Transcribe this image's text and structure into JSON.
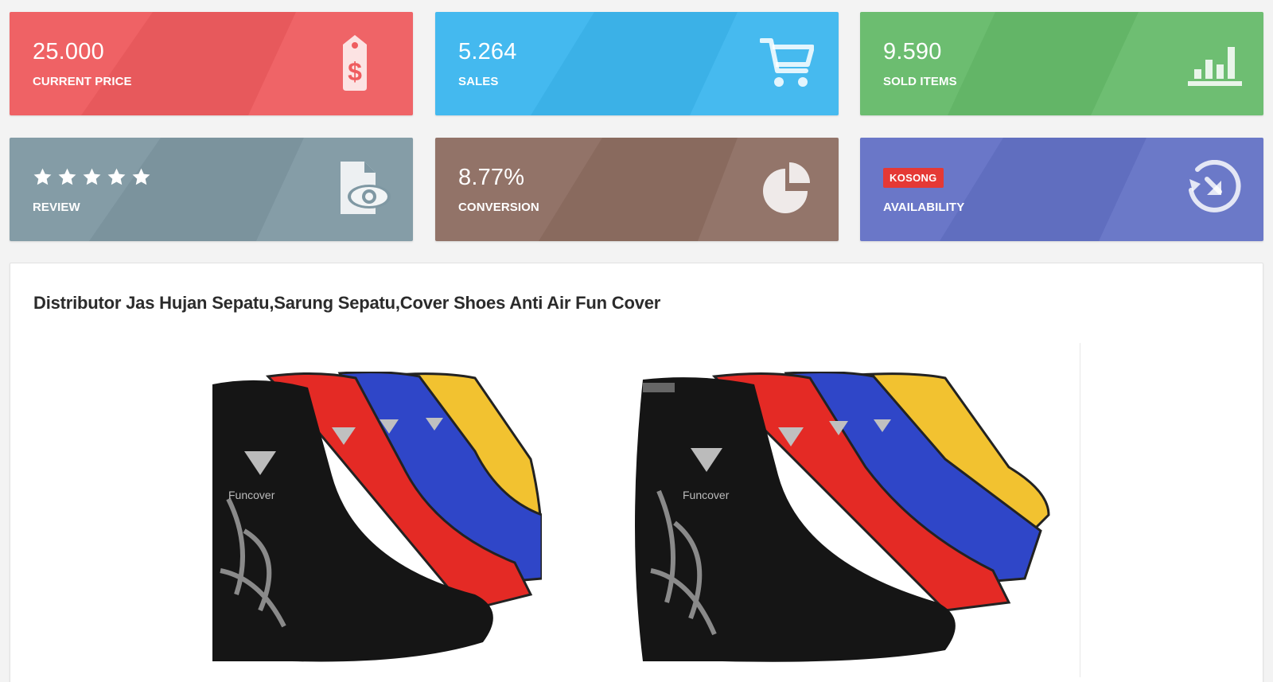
{
  "cards": [
    {
      "value": "25.000",
      "label": "CURRENT PRICE",
      "icon": "price-tag-icon",
      "color": "#ef5c5f"
    },
    {
      "value": "5.264",
      "label": "SALES",
      "icon": "shopping-cart-icon",
      "color": "#3db7ef"
    },
    {
      "value": "9.590",
      "label": "SOLD ITEMS",
      "icon": "bar-chart-icon",
      "color": "#67bb6b"
    },
    {
      "label": "REVIEW",
      "rating": 5,
      "icon": "document-eye-icon",
      "color": "#7f98a3"
    },
    {
      "value": "8.77%",
      "label": "CONVERSION",
      "icon": "pie-chart-icon",
      "color": "#8e6e62"
    },
    {
      "badge": "KOSONG",
      "label": "AVAILABILITY",
      "icon": "history-arrow-icon",
      "color": "#6472c6",
      "badge_color": "#e53935"
    }
  ],
  "product": {
    "title": "Distributor Jas Hujan Sepatu,Sarung Sepatu,Cover Shoes Anti Air Fun Cover",
    "images": [
      {
        "brand_text": "Funcover"
      },
      {
        "brand_text": "Funcover"
      }
    ]
  }
}
